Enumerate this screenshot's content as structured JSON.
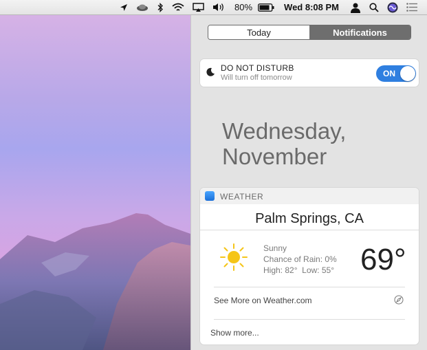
{
  "menubar": {
    "battery_percent": "80%",
    "clock": "Wed 8:08 PM",
    "icons": [
      "location-arrow-icon",
      "cloud-app-icon",
      "bluetooth-icon",
      "wifi-icon",
      "airplay-icon",
      "volume-icon",
      "battery-icon",
      "user-icon",
      "spotlight-search-icon",
      "siri-icon",
      "notification-center-icon"
    ]
  },
  "notification_center": {
    "tabs": [
      {
        "label": "Today",
        "selected": false
      },
      {
        "label": "Notifications",
        "selected": true
      }
    ],
    "dnd": {
      "title": "DO NOT DISTURB",
      "subtitle": "Will turn off tomorrow",
      "toggle_label": "ON",
      "toggle_on": true
    },
    "date": {
      "line1": "Wednesday,",
      "line2": "November"
    },
    "weather": {
      "app_name": "WEATHER",
      "city": "Palm Springs, CA",
      "condition": "Sunny",
      "rain": "Chance of Rain: 0%",
      "high_low": "High: 82°  Low: 55°",
      "temperature": "69°",
      "see_more": "See More on Weather.com",
      "show_more": "Show more..."
    }
  },
  "colors": {
    "toggle": "#2f7fe0",
    "selected_tab": "#6e6e6e",
    "sun": "#f5c518"
  }
}
